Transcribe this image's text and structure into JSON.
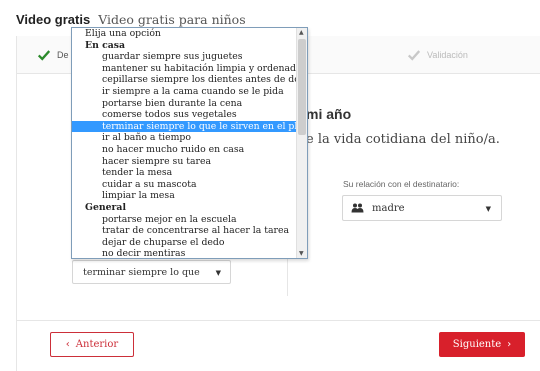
{
  "header": {
    "brand": "Video gratis",
    "subtitle": "Video gratis para niños"
  },
  "steps": [
    {
      "label": "De"
    },
    {
      "label": "Validación"
    }
  ],
  "main": {
    "heading": "mi año",
    "lead": "e la vida cotidiana del niño/a."
  },
  "relation": {
    "label": "Su relación con el destinatario:",
    "value": "madre"
  },
  "select": {
    "value": "terminar siempre lo que le si"
  },
  "dropdown": {
    "options": [
      {
        "label": "Elija una opción",
        "kind": "placeholder"
      },
      {
        "label": "En casa",
        "kind": "group"
      },
      {
        "label": "guardar siempre sus juguetes",
        "kind": "option"
      },
      {
        "label": "mantener su habitación limpia y ordenada",
        "kind": "option"
      },
      {
        "label": "cepillarse siempre los dientes antes de dormir",
        "kind": "option"
      },
      {
        "label": "ir siempre a la cama cuando se le pida",
        "kind": "option"
      },
      {
        "label": "portarse bien durante la cena",
        "kind": "option"
      },
      {
        "label": "comerse todos sus vegetales",
        "kind": "option"
      },
      {
        "label": "terminar siempre lo que le sirven en el plato",
        "kind": "selected"
      },
      {
        "label": "ir al baño a tiempo",
        "kind": "option"
      },
      {
        "label": "no hacer mucho ruido en casa",
        "kind": "option"
      },
      {
        "label": "hacer siempre su tarea",
        "kind": "option"
      },
      {
        "label": "tender la mesa",
        "kind": "option"
      },
      {
        "label": "cuidar a su mascota",
        "kind": "option"
      },
      {
        "label": "limpiar la mesa",
        "kind": "option"
      },
      {
        "label": "General",
        "kind": "group"
      },
      {
        "label": "portarse mejor en la escuela",
        "kind": "option"
      },
      {
        "label": "tratar de concentrarse al hacer la tarea",
        "kind": "option"
      },
      {
        "label": "dejar de chuparse el dedo",
        "kind": "option"
      },
      {
        "label": "no decir mentiras",
        "kind": "option"
      }
    ]
  },
  "buttons": {
    "prev": "Anterior",
    "next": "Siguiente"
  },
  "colors": {
    "accent": "#d8202b",
    "check": "#2b8a2b",
    "selection": "#3399ff"
  },
  "icons": {
    "step_done": "check-icon",
    "step_pending": "check-icon",
    "relation": "users-icon"
  }
}
